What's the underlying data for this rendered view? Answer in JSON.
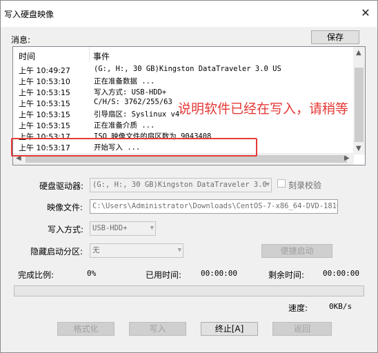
{
  "window": {
    "title": "写入硬盘映像",
    "close_glyph": "✕"
  },
  "messages": {
    "label": "消息:",
    "save_button": "保存",
    "columns": {
      "time": "时间",
      "event": "事件"
    },
    "rows": [
      {
        "time": "上午 10:49:27",
        "event": "(G:, H:, 30 GB)Kingston DataTraveler 3.0 US"
      },
      {
        "time": "上午 10:53:10",
        "event": "正在准备数据 ..."
      },
      {
        "time": "上午 10:53:15",
        "event": "写入方式: USB-HDD+"
      },
      {
        "time": "上午 10:53:15",
        "event": "C/H/S: 3762/255/63"
      },
      {
        "time": "上午 10:53:15",
        "event": "引导扇区: Syslinux v4"
      },
      {
        "time": "上午 10:53:15",
        "event": "正在准备介质 ..."
      },
      {
        "time": "上午 10:53:17",
        "event": "ISO 映像文件的扇区数为 9043408"
      },
      {
        "time": "上午 10:53:17",
        "event": "开始写入 ..."
      }
    ],
    "annotation": "说明软件已经在写入，请稍等"
  },
  "form": {
    "drive_label": "硬盘驱动器:",
    "drive_value": "(G:, H:, 30 GB)Kingston DataTraveler 3.0 US",
    "verify_label": "刻录校验",
    "image_label": "映像文件:",
    "image_value": "C:\\Users\\Administrator\\Downloads\\CentOS-7-x86_64-DVD-1810.iso",
    "method_label": "写入方式:",
    "method_value": "USB-HDD+",
    "hidden_label": "隐藏启动分区:",
    "hidden_value": "无",
    "quick_boot_button": "便捷启动"
  },
  "progress": {
    "done_label": "完成比例:",
    "done_value": "0%",
    "fraction": 0,
    "elapsed_label": "已用时间:",
    "elapsed_value": "00:00:00",
    "remaining_label": "剩余时间:",
    "remaining_value": "00:00:00",
    "speed_label": "速度:",
    "speed_value": "0KB/s"
  },
  "buttons": {
    "format": "格式化",
    "write": "写入",
    "stop": "终止[A]",
    "back": "返回"
  },
  "colors": {
    "annotation": "#e53935",
    "progress_fill": "#06b025"
  }
}
